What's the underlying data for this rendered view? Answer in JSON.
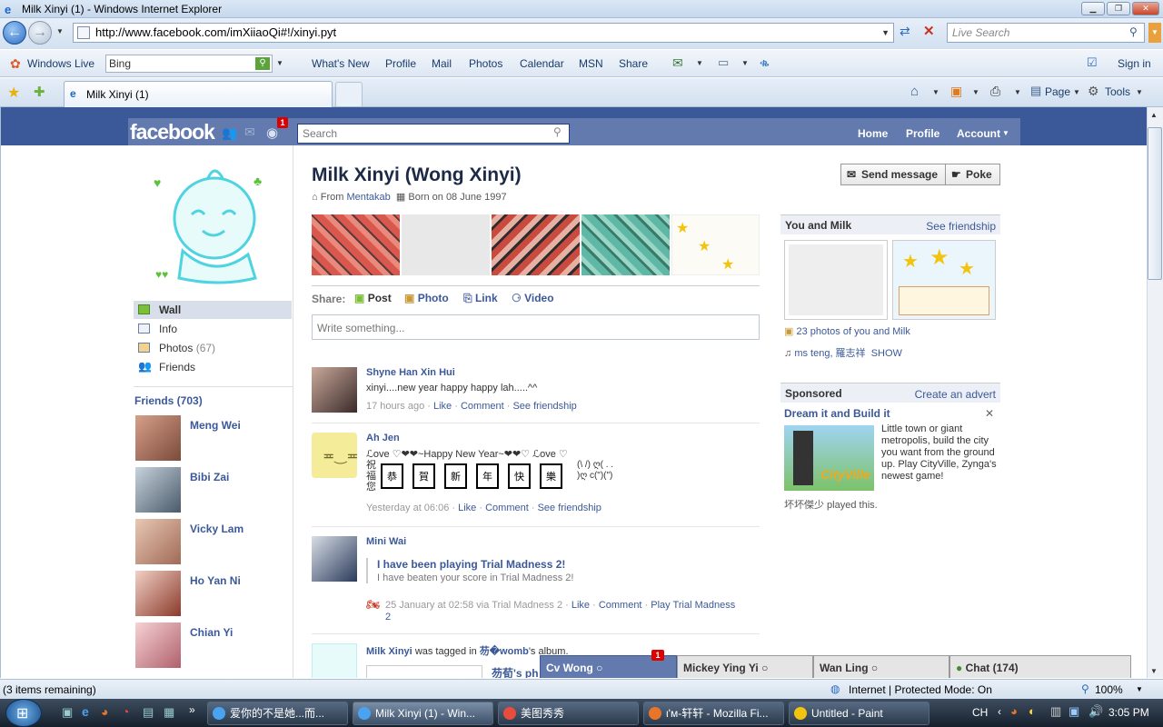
{
  "window": {
    "title": "Milk Xinyi (1) - Windows Internet Explorer"
  },
  "address": {
    "url": "http://www.facebook.com/imXiiaoQi#!/xinyi.pyt",
    "search_placeholder": "Live Search"
  },
  "toolbar2": {
    "windows_live": "Windows Live",
    "bing": "Bing",
    "items": [
      "What's New",
      "Profile",
      "Mail",
      "Photos",
      "Calendar",
      "MSN",
      "Share"
    ],
    "sign_in": "Sign in"
  },
  "tabs": {
    "active": "Milk Xinyi (1)",
    "page": "Page",
    "tools": "Tools"
  },
  "fb": {
    "logo": "facebook",
    "notif_count": "1",
    "search_placeholder": "Search",
    "nav": {
      "home": "Home",
      "profile": "Profile",
      "account": "Account"
    },
    "profile": {
      "name": "Milk Xinyi (Wong Xinyi)",
      "from_label": "From",
      "from": "Mentakab",
      "born": "Born on 08 June 1997",
      "send_message": "Send message",
      "poke": "Poke"
    },
    "leftnav": [
      "Wall",
      "Info",
      "Photos",
      "Friends"
    ],
    "photos_count": "(67)",
    "friends_header": "Friends (703)",
    "friends": [
      "Meng Wei",
      "Bibi Zai",
      "Vicky Lam",
      "Ho Yan Ni",
      "Chian Yi"
    ],
    "share": {
      "label": "Share:",
      "post": "Post",
      "photo": "Photo",
      "link": "Link",
      "video": "Video",
      "placeholder": "Write something..."
    },
    "posts": [
      {
        "name": "Shyne Han Xin Hui",
        "text": "xinyi....new year happy happy lah.....^^",
        "time": "17 hours ago",
        "like": "Like",
        "comment": "Comment",
        "friendship": "See friendship"
      },
      {
        "name": "Ah Jen",
        "text": "ℒove ♡❤❤~Happy New Year~❤❤♡ ℒove ♡",
        "grid_left": "祝 福 您",
        "grid": [
          "恭",
          "賀",
          "新",
          "年",
          "快",
          "樂"
        ],
        "kaomoji": "(\\ /) ღ( . . )ღ c(\")(\")",
        "time": "Yesterday at 06:06",
        "like": "Like",
        "comment": "Comment",
        "friendship": "See friendship"
      },
      {
        "name": "Mini Wai",
        "app_title": "I have been playing Trial Madness 2!",
        "app_text": "I have beaten your score in Trial Madness 2!",
        "time": "25 January at 02:58 via Trial Madness 2",
        "like": "Like",
        "comment": "Comment",
        "play": "Play Trial Madness 2"
      },
      {
        "name": "Milk Xinyi",
        "tagged": "was tagged in",
        "who": "芴�womb",
        "album": "'s album.",
        "sub": "芴荀's ph"
      }
    ],
    "right": {
      "you_and": "You and Milk",
      "see_friendship": "See friendship",
      "photos_of": "23 photos of you and Milk",
      "music": "ms teng, 羅志祥",
      "show": "SHOW",
      "sponsored": "Sponsored",
      "create_advert": "Create an advert",
      "ad_title": "Dream it and Build it",
      "ad_text": "Little town or giant metropolis, build the city you want from the ground up. Play CityVille, Zynga's newest game!",
      "ad_logo": "CityVille",
      "played": "坏坏傑少 played this."
    },
    "chat": {
      "tabs": [
        "Cv Wong",
        "Mickey Ying Yi",
        "Wan Ling"
      ],
      "badge": "1",
      "online": "Chat (174)"
    }
  },
  "statusbar": {
    "left": "(3 items remaining)",
    "zone": "Internet | Protected Mode: On",
    "zoom": "100%"
  },
  "taskbar": {
    "items": [
      "爱你的不是她...而...",
      "Milk Xinyi (1) - Win...",
      "美图秀秀",
      "ι'м-轩轩 - Mozilla Fi...",
      "Untitled - Paint"
    ],
    "lang": "CH",
    "clock": "3:05 PM"
  }
}
